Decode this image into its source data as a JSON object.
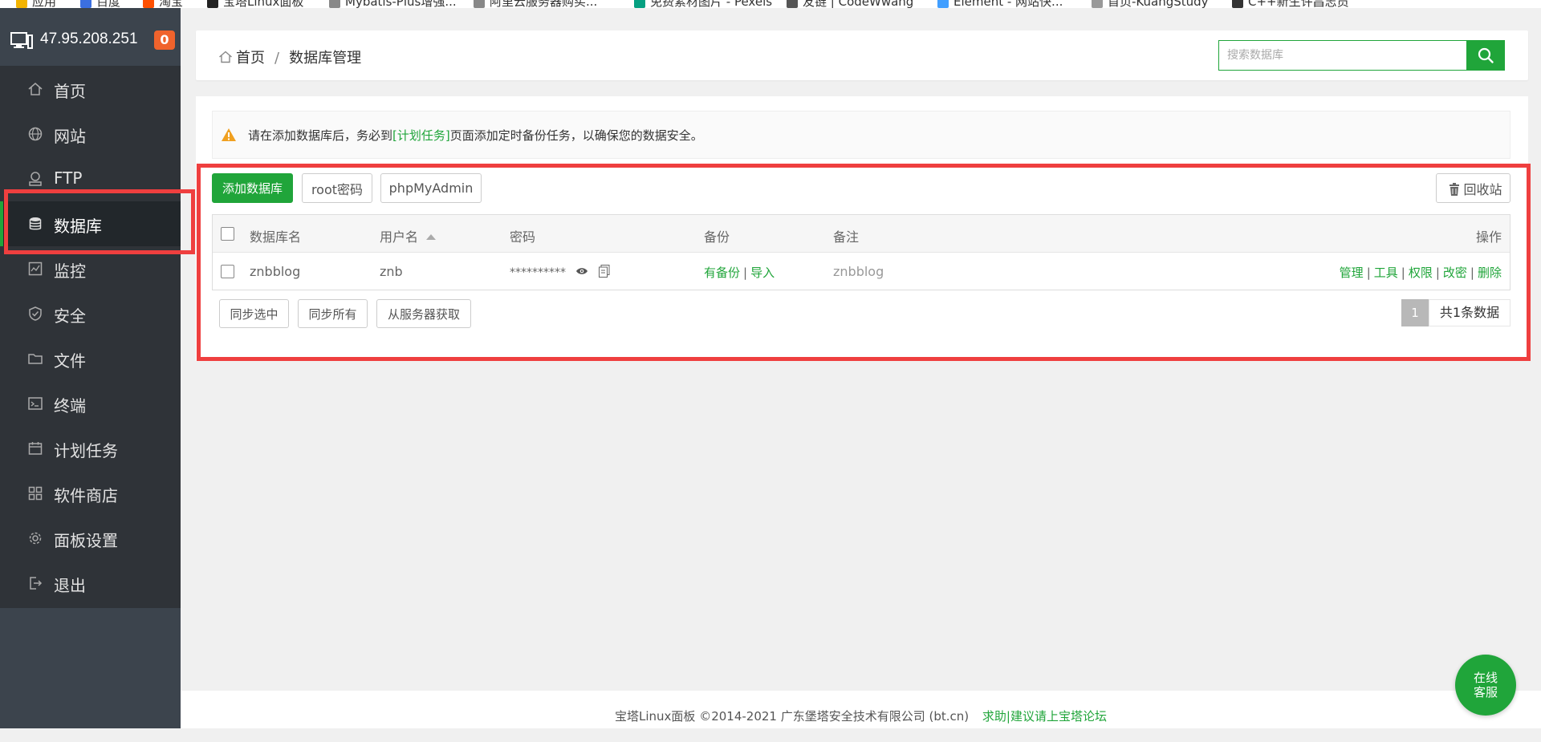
{
  "bookmarks": [
    {
      "label": "应用",
      "color": "#f4b400"
    },
    {
      "label": "百度",
      "color": "#3b6fe0"
    },
    {
      "label": "淘宝",
      "color": "#ff5000"
    },
    {
      "label": "宝塔Linux面板",
      "color": "#222"
    },
    {
      "label": "Mybatis-Plus增强...",
      "color": "#888"
    },
    {
      "label": "阿里云服务器购买...",
      "color": "#888"
    },
    {
      "label": "免费素材图片 - Pexels",
      "color": "#05a081"
    },
    {
      "label": "友链 | CodeWwang",
      "color": "#555"
    },
    {
      "label": "Element - 网站快...",
      "color": "#409eff"
    },
    {
      "label": "首页-KuangStudy",
      "color": "#999"
    },
    {
      "label": "C++新生许昌志员",
      "color": "#333"
    }
  ],
  "server": {
    "ip": "47.95.208.251",
    "badge": "0"
  },
  "sidebar": {
    "items": [
      {
        "label": "首页",
        "icon": "home-icon"
      },
      {
        "label": "网站",
        "icon": "globe-icon"
      },
      {
        "label": "FTP",
        "icon": "ftp-icon"
      },
      {
        "label": "数据库",
        "icon": "database-icon"
      },
      {
        "label": "监控",
        "icon": "monitor-chart-icon"
      },
      {
        "label": "安全",
        "icon": "shield-icon"
      },
      {
        "label": "文件",
        "icon": "folder-icon"
      },
      {
        "label": "终端",
        "icon": "terminal-icon"
      },
      {
        "label": "计划任务",
        "icon": "calendar-icon"
      },
      {
        "label": "软件商店",
        "icon": "apps-grid-icon"
      },
      {
        "label": "面板设置",
        "icon": "gear-icon"
      },
      {
        "label": "退出",
        "icon": "logout-icon"
      }
    ],
    "active_index": 3
  },
  "breadcrumb": {
    "home": "首页",
    "separator": "/",
    "current": "数据库管理"
  },
  "search": {
    "placeholder": "搜索数据库",
    "value": ""
  },
  "notice": {
    "before": "请在添加数据库后，务必到",
    "link": "[计划任务]",
    "after": "页面添加定时备份任务，以确保您的数据安全。"
  },
  "toolbar": {
    "add_db": "添加数据库",
    "root_pwd": "root密码",
    "phpmyadmin": "phpMyAdmin",
    "recycle": "回收站"
  },
  "table": {
    "headers": {
      "name": "数据库名",
      "user": "用户名",
      "password": "密码",
      "backup": "备份",
      "remark": "备注",
      "ops": "操作"
    },
    "rows": [
      {
        "name": "znbblog",
        "user": "znb",
        "password": "**********",
        "backup_status": "有备份",
        "backup_sep": "|",
        "import": "导入",
        "remark": "znbblog",
        "ops": [
          "管理",
          "工具",
          "权限",
          "改密",
          "删除"
        ]
      }
    ]
  },
  "bottom_buttons": {
    "sync_selected": "同步选中",
    "sync_all": "同步所有",
    "fetch_server": "从服务器获取"
  },
  "pager": {
    "current": "1",
    "total_text": "共1条数据"
  },
  "footer": {
    "copyright": "宝塔Linux面板 ©2014-2021 广东堡塔安全技术有限公司 (bt.cn)",
    "help_link": "求助|建议请上宝塔论坛"
  },
  "chat": {
    "line1": "在线",
    "line2": "客服"
  },
  "colors": {
    "accent": "#20a53a",
    "sidebar": "#2f3338",
    "highlight": "#ef3f3f"
  }
}
